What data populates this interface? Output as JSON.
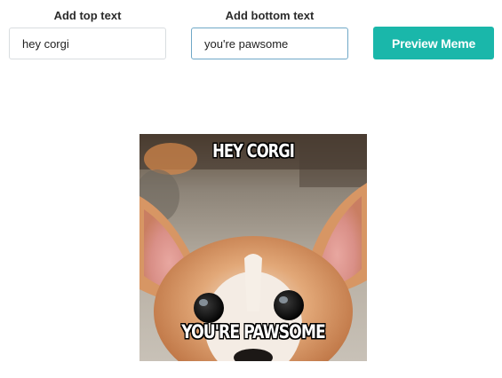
{
  "form": {
    "top_label": "Add top text",
    "top_value": "hey corgi",
    "bottom_label": "Add bottom text",
    "bottom_value": "you're pawsome",
    "preview_button_label": "Preview Meme"
  },
  "meme": {
    "top_caption": "HEY CORGI",
    "bottom_caption": "YOU'RE PAWSOME"
  },
  "colors": {
    "accent": "#1ab7aa",
    "input_focus_border": "#6fa8c7"
  }
}
